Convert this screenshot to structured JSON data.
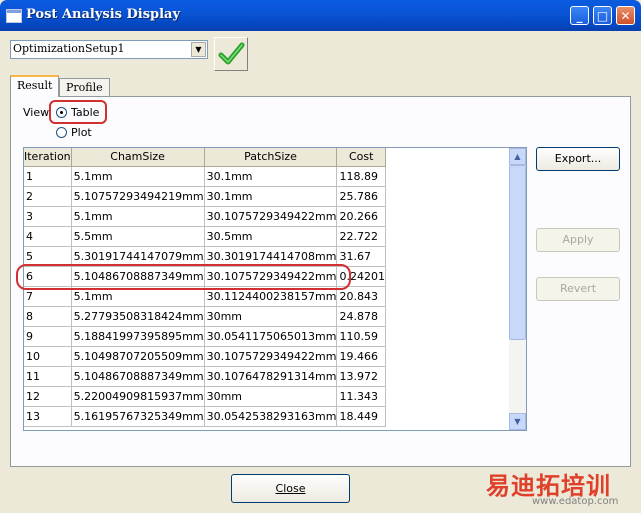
{
  "window": {
    "title": "Post Analysis Display",
    "minimize_glyph": "_",
    "maximize_glyph": "□",
    "close_glyph": "✕"
  },
  "setup_select": {
    "value": "OptimizationSetup1",
    "arrow_glyph": "▼"
  },
  "tabs": [
    {
      "label": "Result"
    },
    {
      "label": "Profile"
    }
  ],
  "view": {
    "label": "View:",
    "options": [
      {
        "label": "Table",
        "selected": true
      },
      {
        "label": "Plot",
        "selected": false
      }
    ]
  },
  "table": {
    "headers": [
      "Iteration",
      "ChamSize",
      "PatchSize",
      "Cost"
    ],
    "rows": [
      [
        "1",
        "5.1mm",
        "30.1mm",
        "118.89"
      ],
      [
        "2",
        "5.10757293494219mm",
        "30.1mm",
        "25.786"
      ],
      [
        "3",
        "5.1mm",
        "30.1075729349422mm",
        "20.266"
      ],
      [
        "4",
        "5.5mm",
        "30.5mm",
        "22.722"
      ],
      [
        "5",
        "5.30191744147079mm",
        "30.3019174414708mm",
        "31.67"
      ],
      [
        "6",
        "5.10486708887349mm",
        "30.1075729349422mm",
        "0.24201"
      ],
      [
        "7",
        "5.1mm",
        "30.1124400238157mm",
        "20.843"
      ],
      [
        "8",
        "5.27793508318424mm",
        "30mm",
        "24.878"
      ],
      [
        "9",
        "5.18841997395895mm",
        "30.0541175065013mm",
        "110.59"
      ],
      [
        "10",
        "5.10498707205509mm",
        "30.1075729349422mm",
        "19.466"
      ],
      [
        "11",
        "5.10486708887349mm",
        "30.1076478291314mm",
        "13.972"
      ],
      [
        "12",
        "5.22004909815937mm",
        "30mm",
        "11.343"
      ],
      [
        "13",
        "5.16195767325349mm",
        "30.0542538293163mm",
        "18.449"
      ]
    ]
  },
  "buttons": {
    "export": "Export...",
    "apply": "Apply",
    "revert": "Revert",
    "close": "Close"
  },
  "watermark": {
    "text": "易迪拓培训",
    "url": "www.edatop.com"
  },
  "colors": {
    "titlebar": "#0a54d6",
    "highlight": "#d03030",
    "check": "#2aa02a"
  }
}
